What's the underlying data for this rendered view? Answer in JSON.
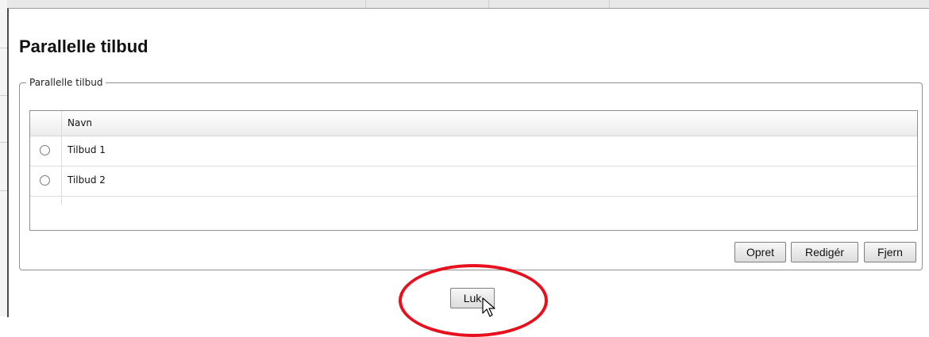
{
  "dialog": {
    "title": "Parallelle tilbud",
    "group_legend": "Parallelle tilbud"
  },
  "grid": {
    "columns": [
      "Navn"
    ],
    "rows": [
      {
        "name": "Tilbud 1",
        "selected": false
      },
      {
        "name": "Tilbud 2",
        "selected": false
      }
    ]
  },
  "actions": {
    "create_label": "Opret",
    "edit_label": "Redigér",
    "remove_label": "Fjern"
  },
  "footer": {
    "close_label": "Luk"
  },
  "annotation": {
    "highlight_color": "#e8101c",
    "highlight_target": "close-button"
  }
}
